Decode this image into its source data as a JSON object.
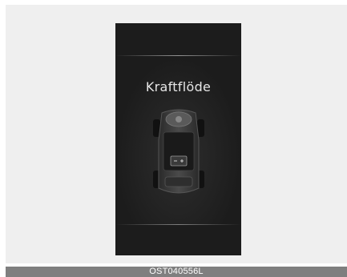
{
  "screen": {
    "title": "Kraftflöde",
    "icon": "car-topview-icon"
  },
  "caption": {
    "code": "OST040556L"
  },
  "colors": {
    "screen_background": "#1c1c1c",
    "frame_background": "#efefef",
    "caption_bar": "#7f7f7f",
    "title_text": "#e6e6e6"
  }
}
